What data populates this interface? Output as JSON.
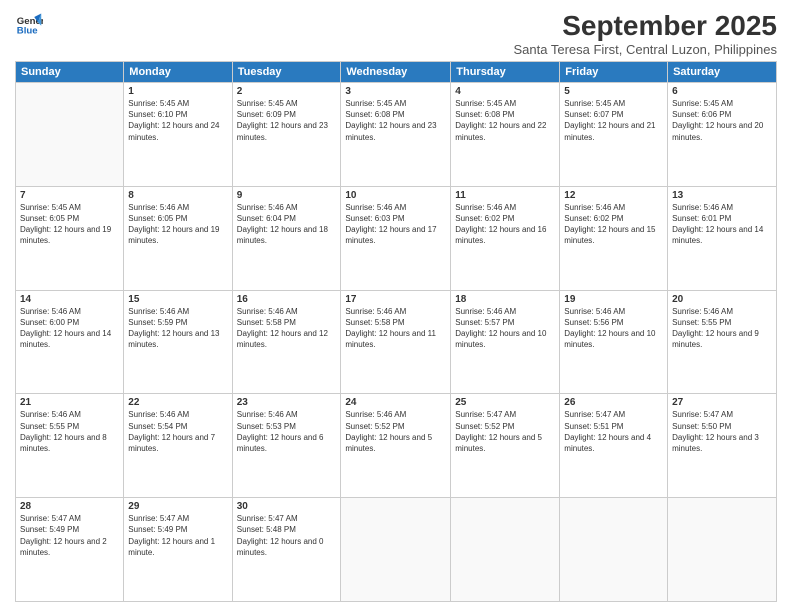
{
  "logo": {
    "line1": "General",
    "line2": "Blue"
  },
  "title": "September 2025",
  "subtitle": "Santa Teresa First, Central Luzon, Philippines",
  "days_header": [
    "Sunday",
    "Monday",
    "Tuesday",
    "Wednesday",
    "Thursday",
    "Friday",
    "Saturday"
  ],
  "weeks": [
    [
      {
        "day": "",
        "sunrise": "",
        "sunset": "",
        "daylight": ""
      },
      {
        "day": "1",
        "sunrise": "Sunrise: 5:45 AM",
        "sunset": "Sunset: 6:10 PM",
        "daylight": "Daylight: 12 hours and 24 minutes."
      },
      {
        "day": "2",
        "sunrise": "Sunrise: 5:45 AM",
        "sunset": "Sunset: 6:09 PM",
        "daylight": "Daylight: 12 hours and 23 minutes."
      },
      {
        "day": "3",
        "sunrise": "Sunrise: 5:45 AM",
        "sunset": "Sunset: 6:08 PM",
        "daylight": "Daylight: 12 hours and 23 minutes."
      },
      {
        "day": "4",
        "sunrise": "Sunrise: 5:45 AM",
        "sunset": "Sunset: 6:08 PM",
        "daylight": "Daylight: 12 hours and 22 minutes."
      },
      {
        "day": "5",
        "sunrise": "Sunrise: 5:45 AM",
        "sunset": "Sunset: 6:07 PM",
        "daylight": "Daylight: 12 hours and 21 minutes."
      },
      {
        "day": "6",
        "sunrise": "Sunrise: 5:45 AM",
        "sunset": "Sunset: 6:06 PM",
        "daylight": "Daylight: 12 hours and 20 minutes."
      }
    ],
    [
      {
        "day": "7",
        "sunrise": "Sunrise: 5:45 AM",
        "sunset": "Sunset: 6:05 PM",
        "daylight": "Daylight: 12 hours and 19 minutes."
      },
      {
        "day": "8",
        "sunrise": "Sunrise: 5:46 AM",
        "sunset": "Sunset: 6:05 PM",
        "daylight": "Daylight: 12 hours and 19 minutes."
      },
      {
        "day": "9",
        "sunrise": "Sunrise: 5:46 AM",
        "sunset": "Sunset: 6:04 PM",
        "daylight": "Daylight: 12 hours and 18 minutes."
      },
      {
        "day": "10",
        "sunrise": "Sunrise: 5:46 AM",
        "sunset": "Sunset: 6:03 PM",
        "daylight": "Daylight: 12 hours and 17 minutes."
      },
      {
        "day": "11",
        "sunrise": "Sunrise: 5:46 AM",
        "sunset": "Sunset: 6:02 PM",
        "daylight": "Daylight: 12 hours and 16 minutes."
      },
      {
        "day": "12",
        "sunrise": "Sunrise: 5:46 AM",
        "sunset": "Sunset: 6:02 PM",
        "daylight": "Daylight: 12 hours and 15 minutes."
      },
      {
        "day": "13",
        "sunrise": "Sunrise: 5:46 AM",
        "sunset": "Sunset: 6:01 PM",
        "daylight": "Daylight: 12 hours and 14 minutes."
      }
    ],
    [
      {
        "day": "14",
        "sunrise": "Sunrise: 5:46 AM",
        "sunset": "Sunset: 6:00 PM",
        "daylight": "Daylight: 12 hours and 14 minutes."
      },
      {
        "day": "15",
        "sunrise": "Sunrise: 5:46 AM",
        "sunset": "Sunset: 5:59 PM",
        "daylight": "Daylight: 12 hours and 13 minutes."
      },
      {
        "day": "16",
        "sunrise": "Sunrise: 5:46 AM",
        "sunset": "Sunset: 5:58 PM",
        "daylight": "Daylight: 12 hours and 12 minutes."
      },
      {
        "day": "17",
        "sunrise": "Sunrise: 5:46 AM",
        "sunset": "Sunset: 5:58 PM",
        "daylight": "Daylight: 12 hours and 11 minutes."
      },
      {
        "day": "18",
        "sunrise": "Sunrise: 5:46 AM",
        "sunset": "Sunset: 5:57 PM",
        "daylight": "Daylight: 12 hours and 10 minutes."
      },
      {
        "day": "19",
        "sunrise": "Sunrise: 5:46 AM",
        "sunset": "Sunset: 5:56 PM",
        "daylight": "Daylight: 12 hours and 10 minutes."
      },
      {
        "day": "20",
        "sunrise": "Sunrise: 5:46 AM",
        "sunset": "Sunset: 5:55 PM",
        "daylight": "Daylight: 12 hours and 9 minutes."
      }
    ],
    [
      {
        "day": "21",
        "sunrise": "Sunrise: 5:46 AM",
        "sunset": "Sunset: 5:55 PM",
        "daylight": "Daylight: 12 hours and 8 minutes."
      },
      {
        "day": "22",
        "sunrise": "Sunrise: 5:46 AM",
        "sunset": "Sunset: 5:54 PM",
        "daylight": "Daylight: 12 hours and 7 minutes."
      },
      {
        "day": "23",
        "sunrise": "Sunrise: 5:46 AM",
        "sunset": "Sunset: 5:53 PM",
        "daylight": "Daylight: 12 hours and 6 minutes."
      },
      {
        "day": "24",
        "sunrise": "Sunrise: 5:46 AM",
        "sunset": "Sunset: 5:52 PM",
        "daylight": "Daylight: 12 hours and 5 minutes."
      },
      {
        "day": "25",
        "sunrise": "Sunrise: 5:47 AM",
        "sunset": "Sunset: 5:52 PM",
        "daylight": "Daylight: 12 hours and 5 minutes."
      },
      {
        "day": "26",
        "sunrise": "Sunrise: 5:47 AM",
        "sunset": "Sunset: 5:51 PM",
        "daylight": "Daylight: 12 hours and 4 minutes."
      },
      {
        "day": "27",
        "sunrise": "Sunrise: 5:47 AM",
        "sunset": "Sunset: 5:50 PM",
        "daylight": "Daylight: 12 hours and 3 minutes."
      }
    ],
    [
      {
        "day": "28",
        "sunrise": "Sunrise: 5:47 AM",
        "sunset": "Sunset: 5:49 PM",
        "daylight": "Daylight: 12 hours and 2 minutes."
      },
      {
        "day": "29",
        "sunrise": "Sunrise: 5:47 AM",
        "sunset": "Sunset: 5:49 PM",
        "daylight": "Daylight: 12 hours and 1 minute."
      },
      {
        "day": "30",
        "sunrise": "Sunrise: 5:47 AM",
        "sunset": "Sunset: 5:48 PM",
        "daylight": "Daylight: 12 hours and 0 minutes."
      },
      {
        "day": "",
        "sunrise": "",
        "sunset": "",
        "daylight": ""
      },
      {
        "day": "",
        "sunrise": "",
        "sunset": "",
        "daylight": ""
      },
      {
        "day": "",
        "sunrise": "",
        "sunset": "",
        "daylight": ""
      },
      {
        "day": "",
        "sunrise": "",
        "sunset": "",
        "daylight": ""
      }
    ]
  ]
}
